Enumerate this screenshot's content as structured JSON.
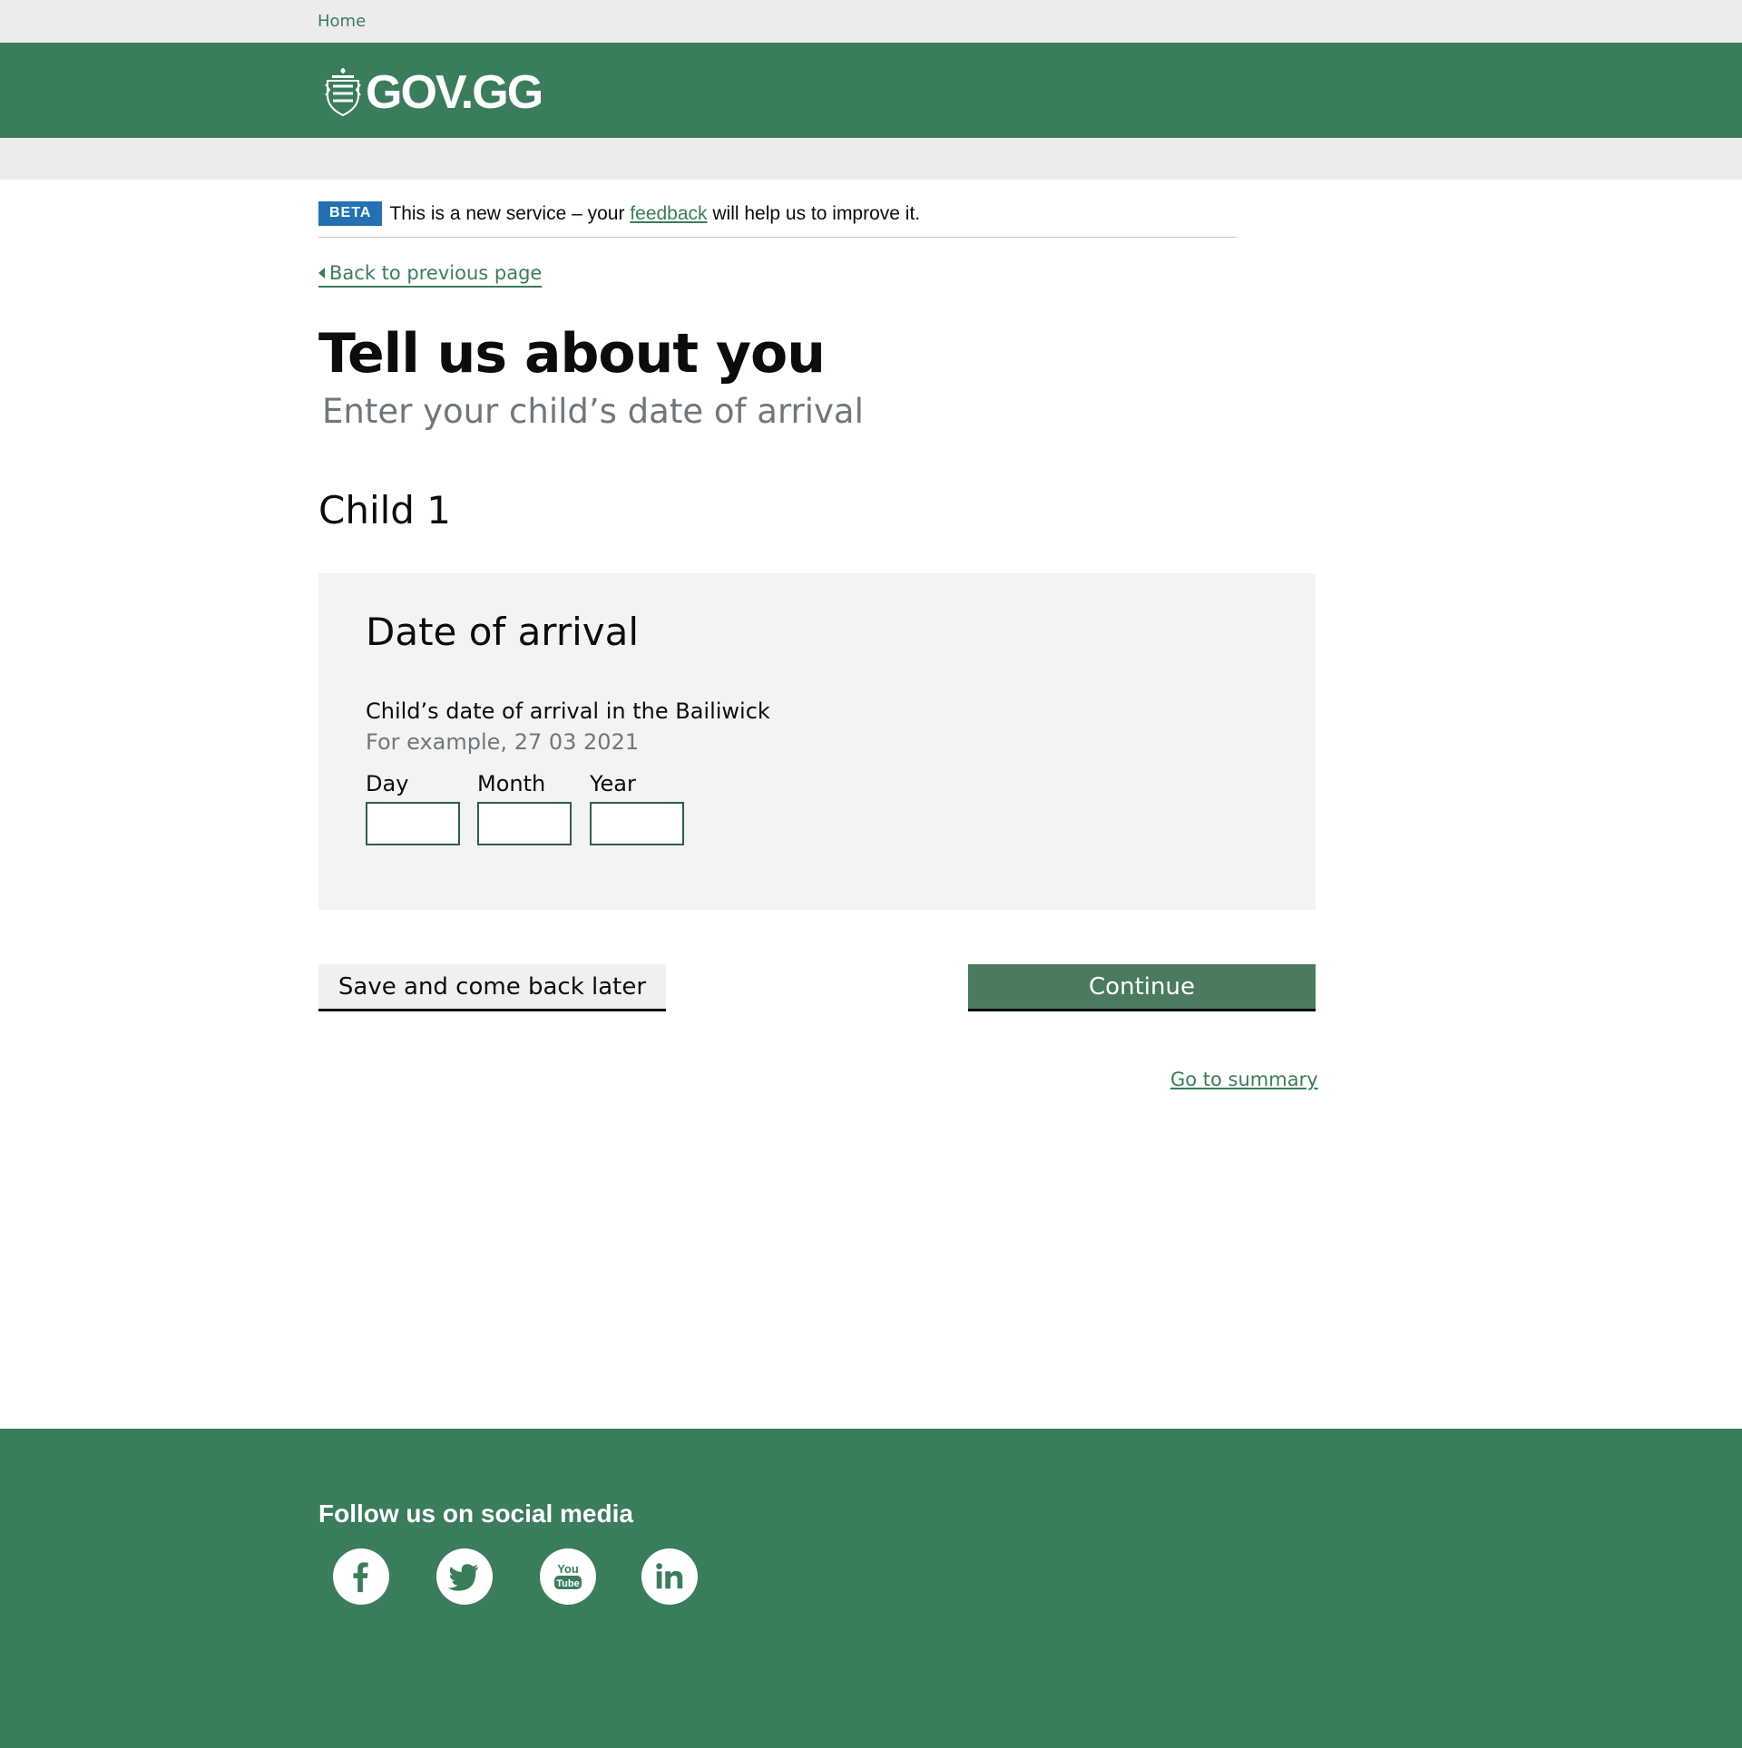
{
  "topbar": {
    "home_link": "Home"
  },
  "header": {
    "logo_text": "GOV.GG"
  },
  "beta_banner": {
    "tag": "BETA",
    "text_before": "This is a new service – your ",
    "link": "feedback",
    "text_after": " will help us to improve it."
  },
  "nav": {
    "back_link": "Back to previous page"
  },
  "page": {
    "title": "Tell us about you",
    "subtitle": "Enter your child’s date of arrival",
    "section": "Child 1"
  },
  "form": {
    "panel_title": "Date of arrival",
    "field_label": "Child’s date of arrival in the Bailiwick",
    "hint": "For example, 27 03 2021",
    "day_label": "Day",
    "month_label": "Month",
    "year_label": "Year",
    "day_value": "",
    "month_value": "",
    "year_value": ""
  },
  "actions": {
    "save_label": "Save and come back later",
    "continue_label": "Continue",
    "summary_link": "Go to summary"
  },
  "footer": {
    "social_heading": "Follow us on social media",
    "icons": [
      "facebook-icon",
      "twitter-icon",
      "youtube-icon",
      "linkedin-icon"
    ]
  },
  "colors": {
    "brand_green": "#3a7d5a",
    "beta_blue": "#2271b3",
    "panel_grey": "#f3f3f3"
  }
}
